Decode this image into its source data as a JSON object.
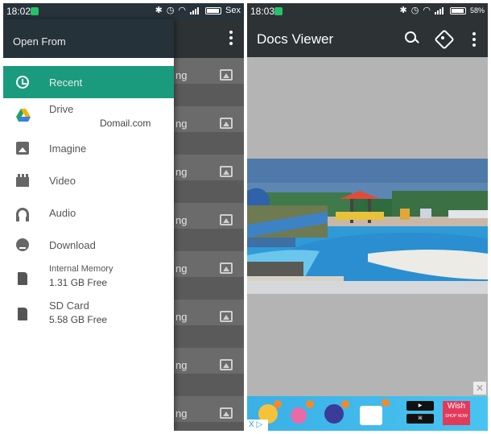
{
  "left": {
    "status": {
      "time": "18:02",
      "day": "Sex"
    },
    "drawer": {
      "title": "Open From",
      "items": [
        {
          "label": "Recent"
        },
        {
          "label": "Drive",
          "sub": "Domail.com"
        },
        {
          "label": "Imagine"
        },
        {
          "label": "Video"
        },
        {
          "label": "Audio"
        },
        {
          "label": "Download"
        },
        {
          "label": "Internal Memory",
          "sub": "1.31 GB Free"
        },
        {
          "label": "SD Card",
          "sub": "5.58 GB Free"
        }
      ]
    },
    "background_list": {
      "fragment": "ng"
    }
  },
  "right": {
    "status": {
      "time": "18:03",
      "battery": "58%"
    },
    "toolbar": {
      "title": "Docs Viewer"
    },
    "ad": {
      "choices": "X ▷",
      "wish": "Wish",
      "wish_cta": "SHOP NOW",
      "close": "✕"
    }
  },
  "colors": {
    "toolbar": "#2d3235",
    "accent": "#1a9b7d",
    "statusbar": "#27323a"
  },
  "icons": [
    "clock-icon",
    "google-drive-icon",
    "image-icon",
    "video-icon",
    "headphones-icon",
    "download-icon",
    "sd-card-icon",
    "search-icon",
    "rotate-icon",
    "more-vert-icon"
  ]
}
